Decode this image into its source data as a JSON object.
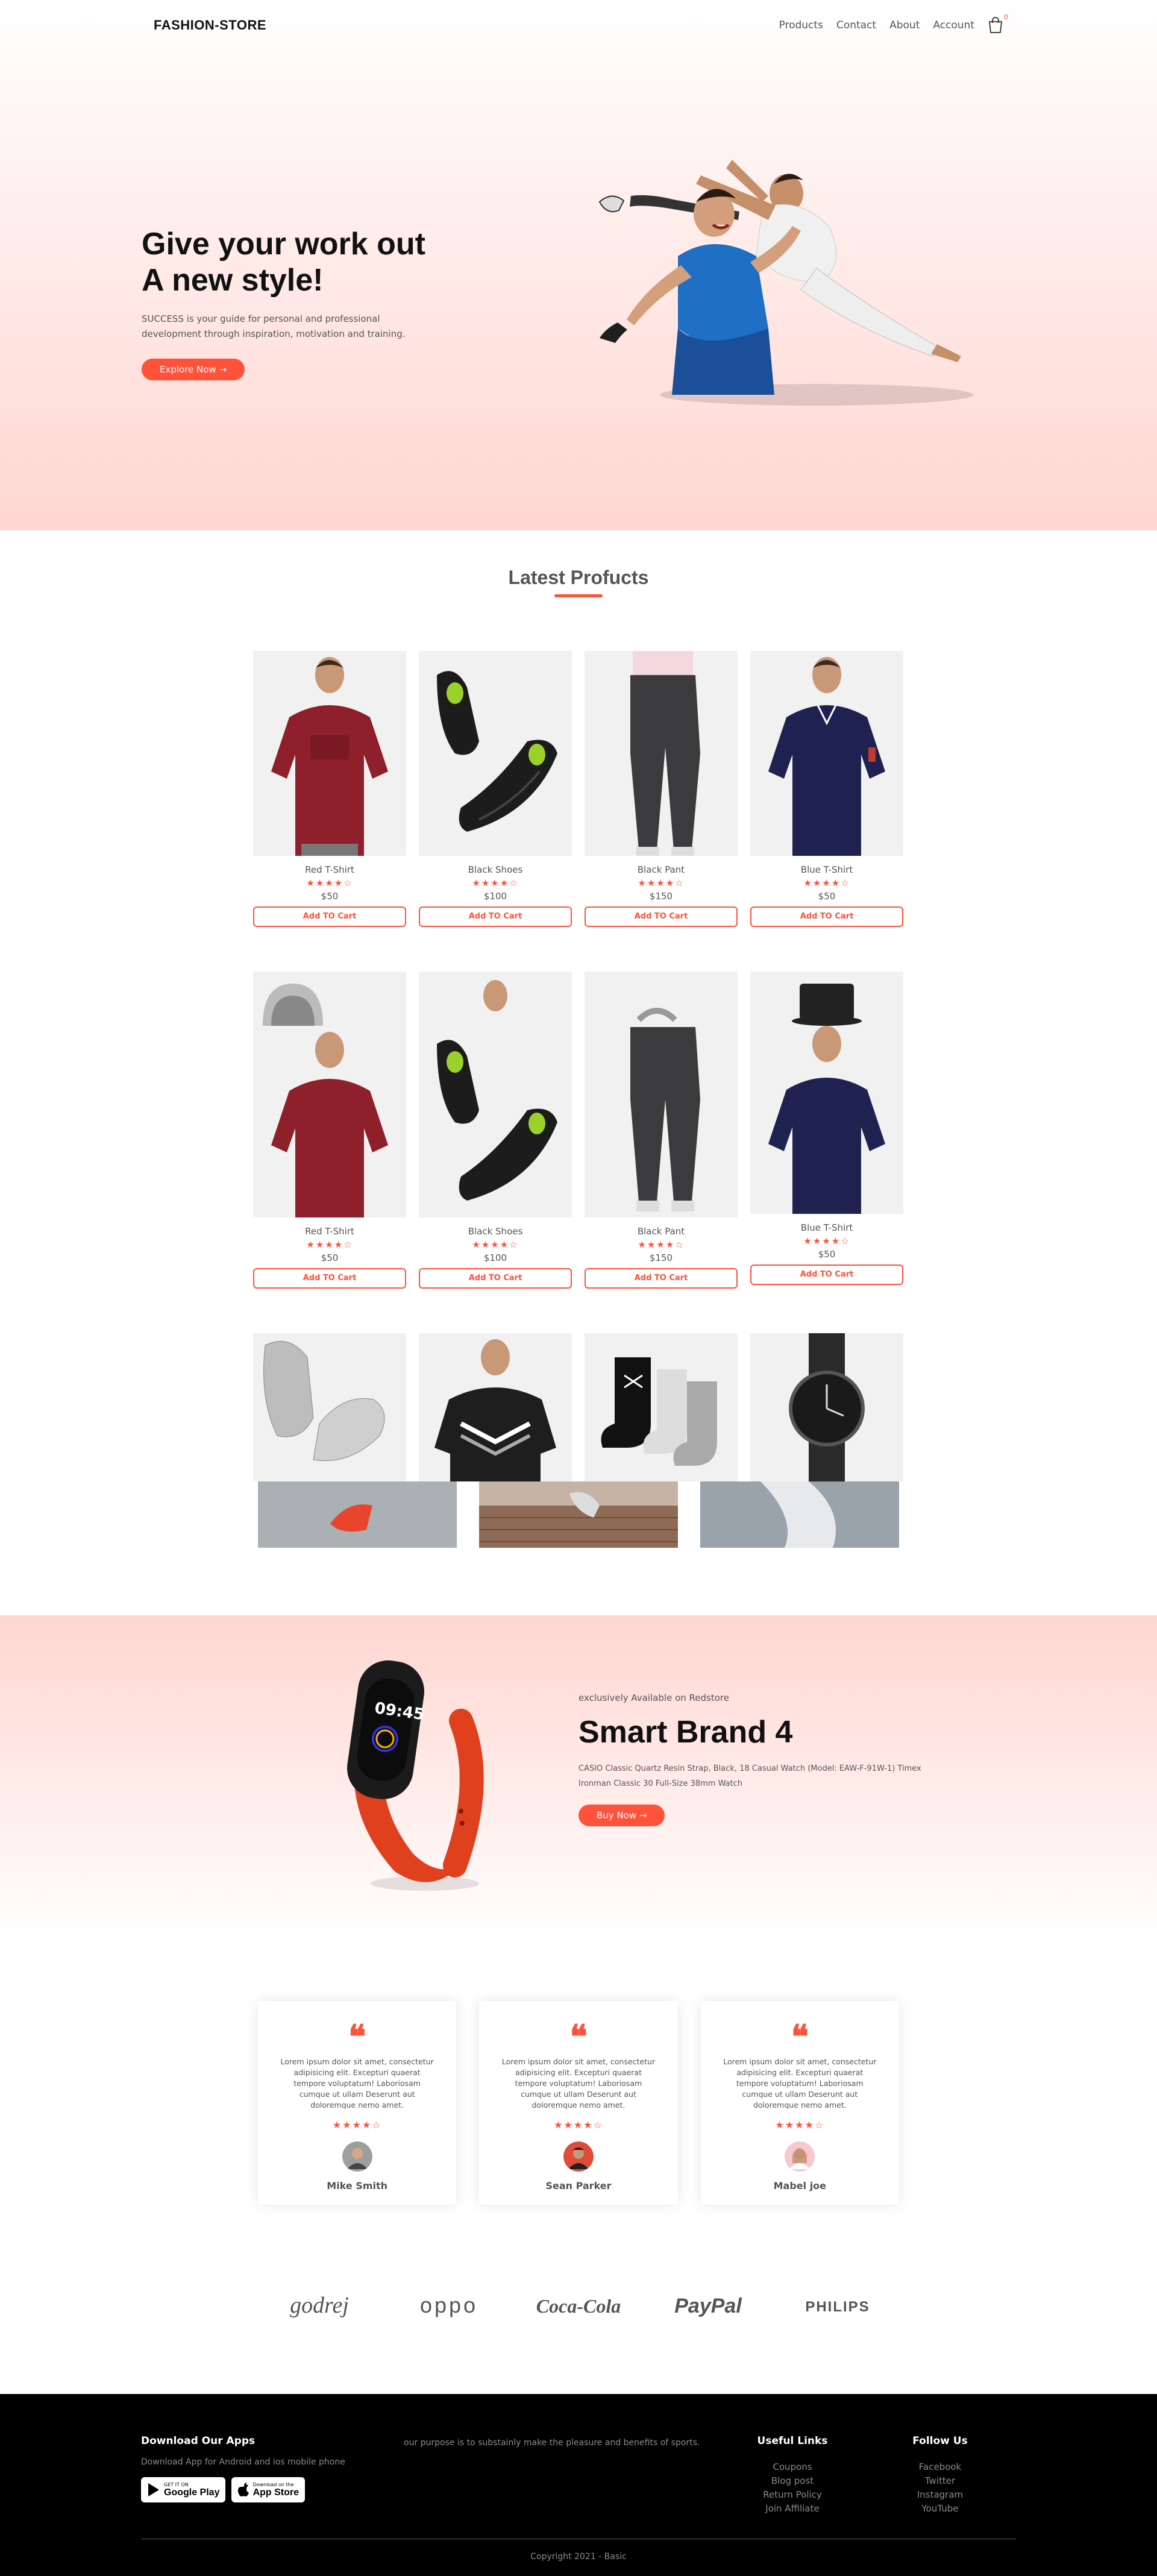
{
  "brand_logo": "FASHION-STORE",
  "nav": {
    "links": [
      "Products",
      "Contact",
      "About",
      "Account"
    ],
    "cart_count": "0"
  },
  "hero": {
    "title_line1": "Give your work out",
    "title_line2": "A new style!",
    "subtitle": "SUCCESS is your guide for personal and professional development through inspiration, motivation and training.",
    "button": "Explore Now →"
  },
  "latest": {
    "title": "Latest Profucts",
    "add_label": "Add TO Cart",
    "row1": [
      {
        "name": "Red T-Shirt",
        "stars": "★★★★☆",
        "price": "$50"
      },
      {
        "name": "Black Shoes",
        "stars": "★★★★☆",
        "price": "$100"
      },
      {
        "name": "Black Pant",
        "stars": "★★★★☆",
        "price": "$150"
      },
      {
        "name": "Blue T-Shirt",
        "stars": "★★★★☆",
        "price": "$50"
      }
    ],
    "row2": [
      {
        "name": "Red T-Shirt",
        "stars": "★★★★☆",
        "price": "$50"
      },
      {
        "name": "Black Shoes",
        "stars": "★★★★☆",
        "price": "$100"
      },
      {
        "name": "Black Pant",
        "stars": "★★★★☆",
        "price": "$150"
      },
      {
        "name": "Blue T-Shirt",
        "stars": "★★★★☆",
        "price": "$50"
      }
    ]
  },
  "offer": {
    "kicker": "exclusively Available on Redstore",
    "title": "Smart Brand 4",
    "description": "CASIO Classic Quartz Resin Strap, Black, 18 Casual Watch (Model: EAW-F-91W-1) Timex Ironman Classic 30 Full-Size 38mm Watch",
    "button": "Buy Now →",
    "watch_time": "09:45"
  },
  "testimonials": [
    {
      "text": "Lorem ipsum dolor sit amet, consectetur adipisicing elit. Excepturi quaerat tempore voluptatum! Laboriosam cumque ut ullam Deserunt aut doloremque nemo amet.",
      "stars": "★★★★☆",
      "name": "Mike Smith"
    },
    {
      "text": "Lorem ipsum dolor sit amet, consectetur adipisicing elit. Excepturi quaerat tempore voluptatum! Laboriosam cumque ut ullam Deserunt aut doloremque nemo amet.",
      "stars": "★★★★☆",
      "name": "Sean Parker"
    },
    {
      "text": "Lorem ipsum dolor sit amet, consectetur adipisicing elit. Excepturi quaerat tempore voluptatum! Laboriosam cumque ut ullam Deserunt aut doloremque nemo amet.",
      "stars": "★★★★☆",
      "name": "Mabel joe"
    }
  ],
  "brands": [
    "godrej",
    "oppo",
    "Coca-Cola",
    "PayPal",
    "PHILIPS"
  ],
  "footer": {
    "apps_title": "Download Our Apps",
    "apps_text": "Download App for Android and ios mobile phone",
    "google_small": "GET IT ON",
    "google_big": "Google Play",
    "apple_small": "Download on the",
    "apple_big": "App Store",
    "purpose": "our purpose is to substainly make the pleasure and benefits of sports.",
    "useful_title": "Useful Links",
    "useful_links": [
      "Coupons",
      "Blog post",
      "Return Policy",
      "Join Affiliate"
    ],
    "follow_title": "Follow Us",
    "follow_links": [
      "Facebook",
      "Twitter",
      "Instagram",
      "YouTube"
    ],
    "copyright": "Copyright 2021 - Basic"
  },
  "colors": {
    "accent": "#ff523b",
    "hero_pink": "#ffd6d1",
    "footer_bg": "#000000"
  }
}
